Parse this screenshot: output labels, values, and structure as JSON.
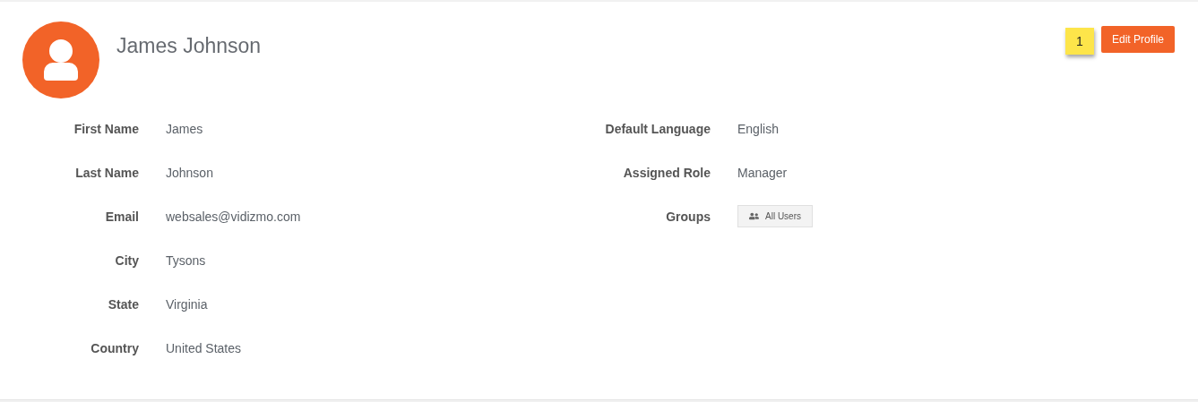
{
  "profile": {
    "name": "James Johnson",
    "badge": "1",
    "edit_button": "Edit Profile"
  },
  "left_fields": [
    {
      "label": "First Name",
      "value": "James",
      "kind": "text"
    },
    {
      "label": "Last Name",
      "value": "Johnson",
      "kind": "text"
    },
    {
      "label": "Email",
      "value": "websales@vidizmo.com",
      "kind": "text"
    },
    {
      "label": "City",
      "value": "Tysons",
      "kind": "text"
    },
    {
      "label": "State",
      "value": "Virginia",
      "kind": "text"
    },
    {
      "label": "Country",
      "value": "United States",
      "kind": "text"
    }
  ],
  "right_fields": [
    {
      "label": "Default Language",
      "value": "English",
      "kind": "text"
    },
    {
      "label": "Assigned Role",
      "value": "Manager",
      "kind": "text"
    },
    {
      "label": "Groups",
      "value": "All Users",
      "kind": "group"
    }
  ]
}
